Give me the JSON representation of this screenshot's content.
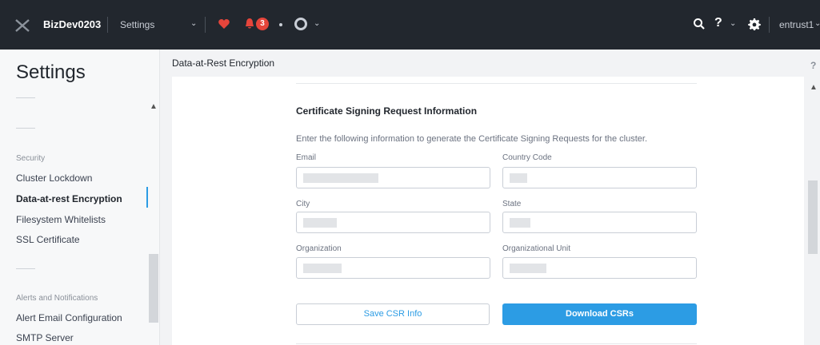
{
  "topbar": {
    "cluster_name": "BizDev0203",
    "settings_label": "Settings",
    "alert_count": "3",
    "user_name": "entrust1",
    "help_label": "?"
  },
  "sidebar": {
    "title": "Settings",
    "sections": [
      {
        "title": "Security",
        "items": [
          "Cluster Lockdown",
          "Data-at-rest Encryption",
          "Filesystem Whitelists",
          "SSL Certificate"
        ]
      },
      {
        "title": "Alerts and Notifications",
        "items": [
          "Alert Email Configuration",
          "SMTP Server"
        ]
      }
    ],
    "active_item": "Data-at-rest Encryption"
  },
  "main": {
    "breadcrumb": "Data-at-Rest Encryption",
    "help_label": "?",
    "form": {
      "title": "Certificate Signing Request Information",
      "description": "Enter the following information to generate the Certificate Signing Requests for the cluster.",
      "fields": {
        "email_label": "Email",
        "country_label": "Country Code",
        "city_label": "City",
        "state_label": "State",
        "org_label": "Organization",
        "org_unit_label": "Organizational Unit"
      },
      "save_button": "Save CSR Info",
      "download_button": "Download CSRs"
    }
  },
  "colors": {
    "accent": "#2c9ce4",
    "topbar": "#22272e",
    "alert": "#e5453b"
  }
}
